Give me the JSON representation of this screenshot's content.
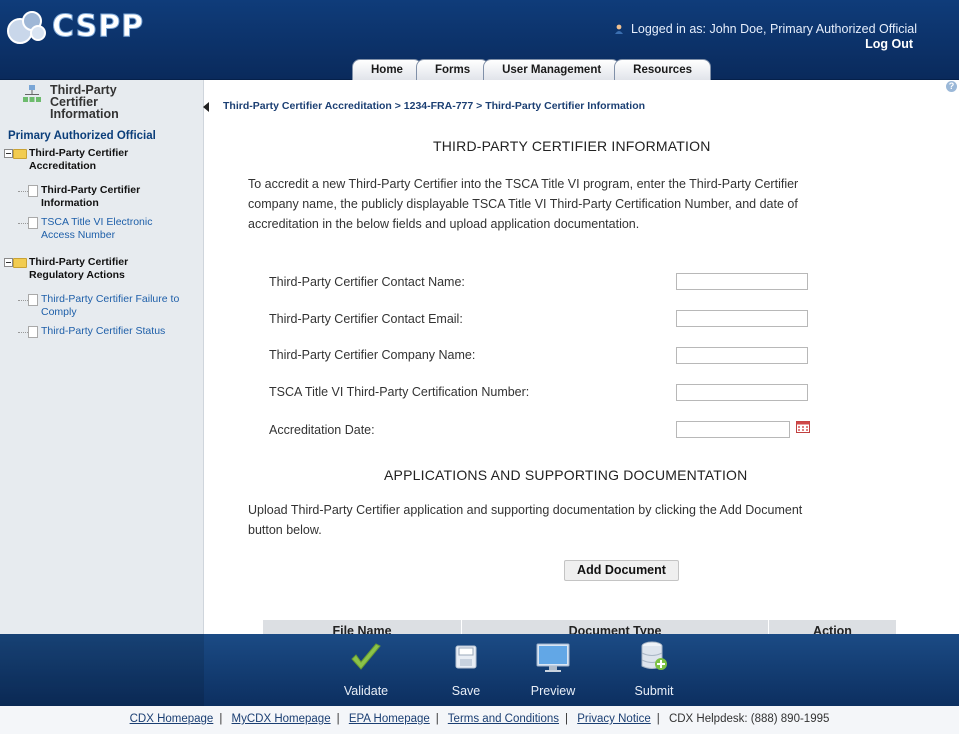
{
  "header": {
    "app_name": "CSPP",
    "logged_in_text": "Logged in as: John Doe, Primary Authorized Official",
    "logout_label": "Log Out",
    "tabs": [
      {
        "label": "Home"
      },
      {
        "label": "Forms"
      },
      {
        "label": "User Management"
      },
      {
        "label": "Resources"
      }
    ]
  },
  "sidebar": {
    "title_line1": "Third-Party",
    "title_line2": "Certifier",
    "title_line3": "Information",
    "role": "Primary Authorized Official",
    "tree": {
      "accreditation_line1": "Third-Party Certifier",
      "accreditation_line2": "Accreditation",
      "certifier_info_line1": "Third-Party Certifier",
      "certifier_info_line2": "Information",
      "access_number_line1": "TSCA Title VI Electronic",
      "access_number_line2": "Access Number",
      "regulatory_line1": "Third-Party Certifier",
      "regulatory_line2": "Regulatory Actions",
      "failure_line1": "Third-Party Certifier Failure to",
      "failure_line2": "Comply",
      "status": "Third-Party Certifier Status"
    }
  },
  "main": {
    "breadcrumb": "Third-Party Certifier Accreditation > 1234-FRA-777 > Third-Party Certifier Information",
    "section1_title": "THIRD-PARTY CERTIFIER INFORMATION",
    "intro_line1": "To accredit a new Third-Party Certifier into the TSCA Title VI program, enter the Third-Party Certifier",
    "intro_line2": "company name, the publicly displayable TSCA Title VI Third-Party Certification Number, and date of",
    "intro_line3": "accreditation in the below fields and upload application documentation.",
    "fields": {
      "contact_name_label": "Third-Party Certifier Contact Name:",
      "contact_name_value": "",
      "contact_email_label": "Third-Party Certifier Contact Email:",
      "contact_email_value": "",
      "company_name_label": "Third-Party Certifier Company Name:",
      "company_name_value": "",
      "cert_number_label": "TSCA Title VI Third-Party Certification Number:",
      "cert_number_value": "",
      "date_label": "Accreditation Date:",
      "date_value": ""
    },
    "section2_title": "APPLICATIONS AND SUPPORTING DOCUMENTATION",
    "upload_line1": "Upload Third-Party Certifier application and supporting documentation by clicking the Add Document",
    "upload_line2": "button below.",
    "add_document_label": "Add Document",
    "table_headers": [
      "File Name",
      "Document Type",
      "Action"
    ]
  },
  "actions": [
    {
      "label": "Validate",
      "icon": "checkmark-icon"
    },
    {
      "label": "Save",
      "icon": "floppy-disk-icon"
    },
    {
      "label": "Preview",
      "icon": "monitor-icon"
    },
    {
      "label": "Submit",
      "icon": "database-submit-icon"
    }
  ],
  "footer": {
    "links": [
      "CDX Homepage",
      "MyCDX Homepage",
      "EPA Homepage",
      "Terms and Conditions",
      "Privacy Notice"
    ],
    "helpdesk": "CDX Helpdesk: (888) 890-1995"
  },
  "colors": {
    "header_blue": "#0f3c7a",
    "breadcrumb_blue": "#1b3f73",
    "link_blue": "#1e5fa9",
    "validate_green": "#8bc34a"
  }
}
